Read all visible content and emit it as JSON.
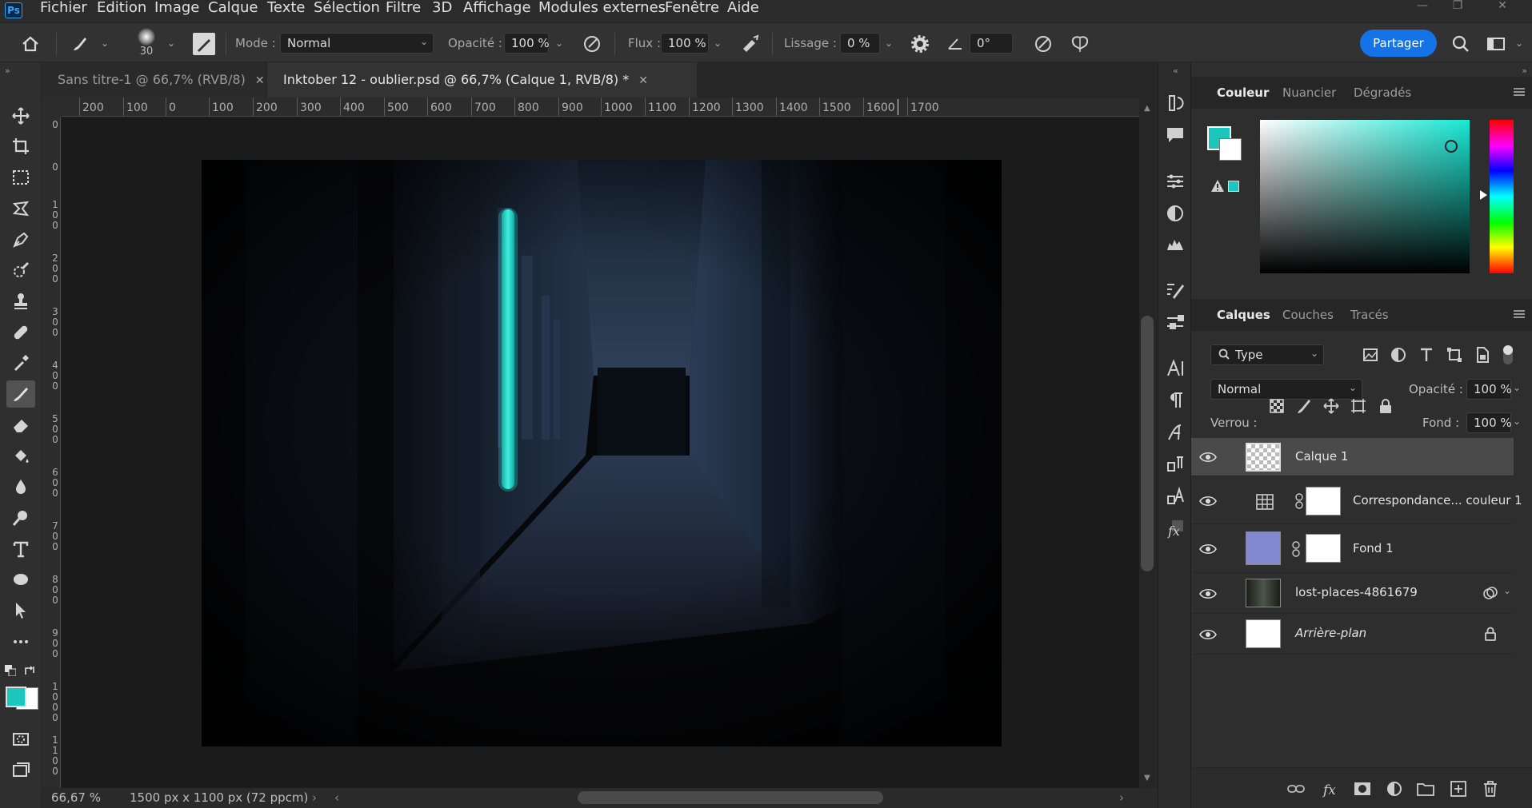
{
  "app": {
    "logo": "Ps"
  },
  "menu": [
    "Fichier",
    "Edition",
    "Image",
    "Calque",
    "Texte",
    "Sélection",
    "Filtre",
    "3D",
    "Affichage",
    "Modules externes",
    "Fenêtre",
    "Aide"
  ],
  "options": {
    "brush_size": "30",
    "mode_label": "Mode :",
    "mode_value": "Normal",
    "opacity_label": "Opacité :",
    "opacity_value": "100 %",
    "flow_label": "Flux :",
    "flow_value": "100 %",
    "smoothing_label": "Lissage :",
    "smoothing_value": "0 %",
    "angle_value": "0°",
    "share_label": "Partager"
  },
  "tabs": [
    {
      "label": "Sans titre-1 @ 66,7% (RVB/8)",
      "active": false
    },
    {
      "label": "Inktober 12 - oublier.psd @ 66,7% (Calque 1, RVB/8) *",
      "active": true
    }
  ],
  "ruler": {
    "horizontal": [
      "200",
      "100",
      "0",
      "100",
      "200",
      "300",
      "400",
      "500",
      "600",
      "700",
      "800",
      "900",
      "1000",
      "1100",
      "1200",
      "1300",
      "1400",
      "1500",
      "1600",
      "1700"
    ],
    "vertical": [
      "0",
      "0",
      "1 0 0",
      "2 0 0",
      "3 0 0",
      "4 0 0",
      "5 0 0",
      "6 0 0",
      "7 0 0",
      "8 0 0",
      "9 0 0",
      "1 0 0 0",
      "1 1 0 0"
    ]
  },
  "status": {
    "zoom": "66,67 %",
    "doc_size": "1500 px x 1100 px (72 ppcm)"
  },
  "color_panel": {
    "tabs": [
      "Couleur",
      "Nuancier",
      "Dégradés"
    ],
    "foreground": "#1cc6bd",
    "background": "#ffffff"
  },
  "layers_panel": {
    "tabs": [
      "Calques",
      "Couches",
      "Tracés"
    ],
    "filter_value": "Type",
    "blend_mode": "Normal",
    "opacity_label": "Opacité :",
    "opacity_value": "100 %",
    "lock_label": "Verrou :",
    "fill_label": "Fond :",
    "fill_value": "100 %",
    "layers": [
      {
        "name": "Calque 1",
        "selected": true
      },
      {
        "name": "Correspondance... couleur 1",
        "selected": false
      },
      {
        "name": "Fond 1",
        "selected": false
      },
      {
        "name": "lost-places-4861679",
        "selected": false
      },
      {
        "name": "Arrière-plan",
        "selected": false
      }
    ]
  },
  "icons": {
    "tools": [
      "move-icon",
      "crop-icon",
      "marquee-icon",
      "lasso-icon",
      "pen-icon",
      "quick-select-icon",
      "stamp-icon",
      "healing-icon",
      "eyedropper-icon",
      "brush-icon",
      "eraser-icon",
      "bucket-icon",
      "blur-icon",
      "dodge-icon",
      "type-icon",
      "ellipse-icon",
      "path-select-icon",
      "more-icon"
    ]
  }
}
